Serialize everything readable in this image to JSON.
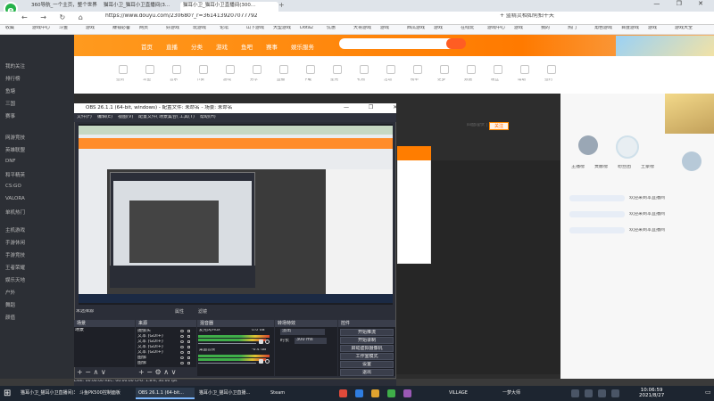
{
  "browser": {
    "tabs": [
      {
        "label": "360导航_一个主页，整个世界"
      },
      {
        "label": "猫耳小卫_猫耳小卫直播间(3..."
      },
      {
        "label": "猫耳小卫_猫耳小卫直播间(300..."
      }
    ],
    "new_tab": "+",
    "window_controls": "— ❐ ✕",
    "nav_glyphs": "← → ↻ ⌂",
    "url": "https://www.douyu.com/230680?_r=3614139207077792",
    "addr_right": "+ 蓝精灵相如何拍十天",
    "bookmarks": [
      "收藏",
      "游戏中心",
      "斗鱼",
      "游戏",
      "赚钱必备",
      "网页",
      "好游戏",
      "玩游戏",
      "论坛",
      "山下游戏",
      "大型游戏",
      "Dota2",
      "优惠",
      "大将游戏",
      "游戏",
      "西瓜游戏",
      "游戏",
      "在线玩",
      "游戏中心",
      "游戏",
      "我的",
      "热门",
      "角色游戏",
      "百度游戏",
      "游戏",
      "游戏大全"
    ]
  },
  "site": {
    "nav": [
      "首页",
      "直播",
      "分类",
      "游戏",
      "鱼吧",
      "赛事",
      "娱乐服务"
    ],
    "sidebar": [
      "我的关注",
      "排行榜",
      "鱼塘",
      "三国",
      "赛事",
      "网游竞技",
      "英雄联盟",
      "DNF",
      "和平精英",
      "CS:GO",
      "VALORA",
      "单机热门",
      "主机游戏",
      "手游休闲",
      "手游竞技",
      "王者荣耀",
      "娱乐天地",
      "户外",
      "舞蹈",
      "颜值"
    ],
    "icons": [
      "签到",
      "斗鱼",
      "音乐",
      "节奏",
      "游戏",
      "分享",
      "直播",
      "下载",
      "星光",
      "礼物",
      "活动",
      "榜单",
      "更多",
      "频道",
      "粉丝",
      "帮助",
      "签约"
    ],
    "streamer_name": "四面埋伏 | 关注",
    "follow": "关注",
    "chat": [
      "欢迎来到本直播间",
      "欢迎来到本直播间",
      "欢迎来到本直播间"
    ],
    "panel_right": [
      "主播榜",
      "贡献榜",
      "粉丝团",
      "土豪榜"
    ]
  },
  "obs": {
    "title": "OBS 26.1.1 (64-bit, windows) - 配置文件: 未命名 - 场景: 未命名",
    "menus": [
      "文件(F)",
      "编辑(E)",
      "视图(V)",
      "配置文件(P)",
      "场景集合(S)",
      "工具(T)",
      "帮助(H)"
    ],
    "scene_label": "未选择源",
    "preview_controls": [
      "属性",
      "滤镜"
    ],
    "docks": {
      "scenes": "场景",
      "sources": "来源",
      "mixer": "混音器",
      "transitions": "转场特效",
      "controls": "控件"
    },
    "scene_item": "场景",
    "sources": [
      "摄像头",
      "文本 (GDI+)",
      "文本 (GDI+)",
      "文本 (GDI+)",
      "文本 (GDI+)",
      "图像",
      "图像"
    ],
    "mixer": [
      {
        "name": "麦克风/Aux",
        "db": "0.0 dB"
      },
      {
        "name": "桌面音频",
        "db": "-6.4 dB"
      }
    ],
    "transition": {
      "type": "淡出",
      "duration_label": "时长",
      "duration": "300 ms"
    },
    "controls": [
      "开始推流",
      "开始录制",
      "启动虚拟摄像机",
      "工作室模式",
      "设置",
      "退出"
    ],
    "status": "LIVE: 00:00:00   REC: 00:00:00   CPU: 1.8%, 30.00 fps"
  },
  "taskbar": {
    "start": "⊞",
    "tasks": [
      {
        "label": "猫耳小卫_猫耳小卫直播间(3..."
      },
      {
        "label": "斗鱼PK500控制面板"
      },
      {
        "label": "OBS 26.1.1 (64-bit..."
      },
      {
        "label": "猫耳小卫_猫耳小卫直播..."
      },
      {
        "label": "Steam"
      },
      {
        "label": "VILLAGE"
      },
      {
        "label": "一梦大师"
      }
    ],
    "time": "10:06:59",
    "date": "2021/8/27",
    "notifications": "▭"
  },
  "colors": {
    "accent": "#ff8a00",
    "obs_bg": "#2b2e38",
    "taskbar": "#1d2530"
  }
}
